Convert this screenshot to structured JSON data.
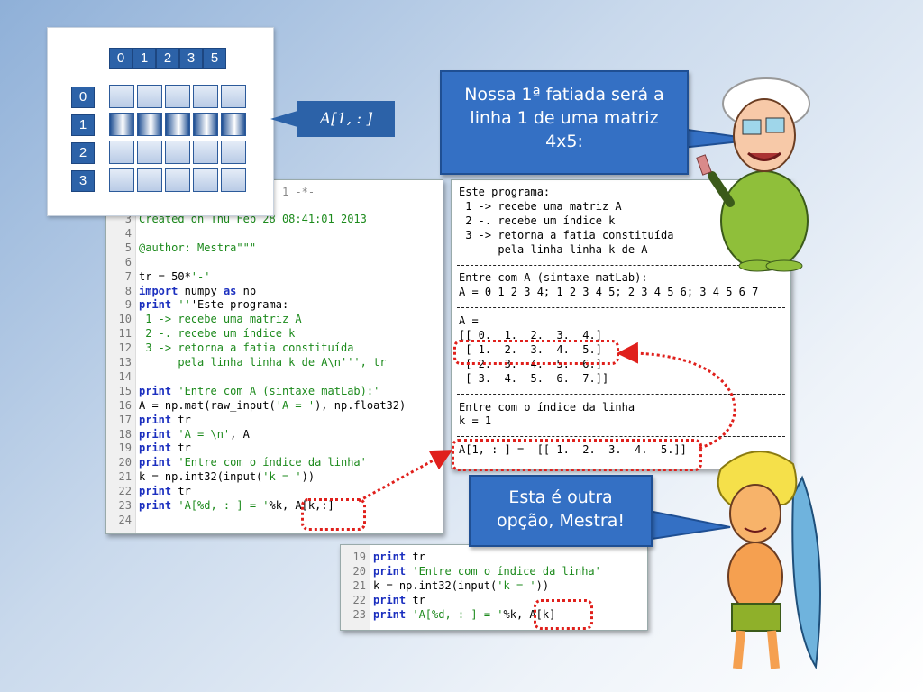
{
  "matrix_panel": {
    "col_headers": [
      "0",
      "1",
      "2",
      "3",
      "5"
    ],
    "row_headers": [
      "0",
      "1",
      "2",
      "3"
    ],
    "highlight_row": 1
  },
  "slice_label": "A[1, : ]",
  "bubbles": {
    "teacher": "Nossa 1ª fatiada será a linha 1 de uma matriz 4x5:",
    "student": "Esta é outra opção, Mestra!"
  },
  "editor": {
    "partial_header": "1 -*-",
    "lines": [
      {
        "n": "3",
        "t": "Created on Thu Feb 28 08:41:01 2013"
      },
      {
        "n": "4",
        "t": ""
      },
      {
        "n": "5",
        "t": "@author: Mestra\"\"\""
      },
      {
        "n": "6",
        "t": ""
      },
      {
        "n": "7",
        "t": "tr = 50*'-'"
      },
      {
        "n": "8",
        "t": "import numpy as np"
      },
      {
        "n": "9",
        "t": "print '''Este programa:"
      },
      {
        "n": "10",
        "t": " 1 -> recebe uma matriz A"
      },
      {
        "n": "11",
        "t": " 2 -. recebe um índice k"
      },
      {
        "n": "12",
        "t": " 3 -> retorna a fatia constituída"
      },
      {
        "n": "13",
        "t": "      pela linha linha k de A\\n''', tr"
      },
      {
        "n": "14",
        "t": ""
      },
      {
        "n": "15",
        "t": "print 'Entre com A (sintaxe matLab):'"
      },
      {
        "n": "16",
        "t": "A = np.mat(raw_input('A = '), np.float32)"
      },
      {
        "n": "17",
        "t": "print tr"
      },
      {
        "n": "18",
        "t": "print 'A = \\n', A"
      },
      {
        "n": "19",
        "t": "print tr"
      },
      {
        "n": "20",
        "t": "print 'Entre com o índice da linha'"
      },
      {
        "n": "21",
        "t": "k = np.int32(input('k = '))"
      },
      {
        "n": "22",
        "t": "print tr"
      },
      {
        "n": "23",
        "t": "print 'A[%d, : ] = '%k, A[k,:]"
      },
      {
        "n": "24",
        "t": ""
      }
    ]
  },
  "output": {
    "lines": [
      "Este programa:",
      " 1 -> recebe uma matriz A",
      " 2 -. recebe um índice k",
      " 3 -> retorna a fatia constituída",
      "      pela linha linha k de A",
      "--------------------------------------------------",
      "Entre com A (sintaxe matLab):",
      "A = 0 1 2 3 4; 1 2 3 4 5; 2 3 4 5 6; 3 4 5 6 7",
      "--------------------------------------------------",
      "A =",
      "[[ 0.  1.  2.  3.  4.]",
      " [ 1.  2.  3.  4.  5.]",
      " [ 2.  3.  4.  5.  6.]",
      " [ 3.  4.  5.  6.  7.]]",
      "--------------------------------------------------",
      "Entre com o índice da linha",
      "k = 1",
      "--------------------------------------------------",
      "A[1, : ] =  [[ 1.  2.  3.  4.  5.]]"
    ]
  },
  "editor2": {
    "lines": [
      {
        "n": "19",
        "t": "print tr"
      },
      {
        "n": "20",
        "t": "print 'Entre com o índice da linha'"
      },
      {
        "n": "21",
        "t": "k = np.int32(input('k = '))"
      },
      {
        "n": "22",
        "t": "print tr"
      },
      {
        "n": "23",
        "t": "print 'A[%d, : ] = '%k, A[k]"
      }
    ]
  }
}
